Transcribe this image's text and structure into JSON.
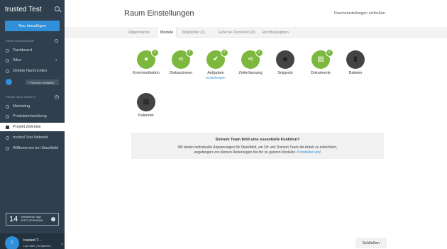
{
  "sidebar": {
    "brand": "trusted Test",
    "add_button": "Neu hinzufügen",
    "org_section": "DEINE ORGANISATION",
    "nav": [
      {
        "label": "Dashboard",
        "icon": "dashboard-icon"
      },
      {
        "label": "Alles",
        "icon": "feed-icon"
      },
      {
        "label": "Direkte Nachrichten",
        "icon": "chat-icon"
      }
    ],
    "invite": "+ Personen einladen",
    "rooms_section": "RÄUME NACH NAMEN ▾",
    "rooms": [
      {
        "label": "Marketing",
        "active": false
      },
      {
        "label": "Produktentwicklung",
        "active": false
      },
      {
        "label": "Projekt Zeitreise",
        "active": true
      },
      {
        "label": "trusted Test Network",
        "active": false
      },
      {
        "label": "Willkommen bei Stackfield",
        "active": false
      }
    ],
    "trial": {
      "days": "14",
      "line1": "verbleibende Tage",
      "line2": "JETZT UPGRADEN"
    },
    "user": {
      "initial": "T",
      "name": "trusted T. -",
      "status": "Live Hilfe | Empfehlen"
    }
  },
  "header": {
    "title": "Raum Einstellungen",
    "close_link": "Raumeinstellungen schließen"
  },
  "tabs": [
    {
      "label": "Allgemeines",
      "active": false
    },
    {
      "label": "Module",
      "active": true
    },
    {
      "label": "Mitglieder (1)",
      "active": false
    },
    {
      "label": "Externe Personen (0)",
      "active": false
    },
    {
      "label": "Rechtegruppen",
      "active": false
    }
  ],
  "modules": [
    {
      "label": "Kommunikation",
      "enabled": true,
      "icon": "chat-bubble-icon"
    },
    {
      "label": "Diskussionen",
      "enabled": true,
      "icon": "share-icon"
    },
    {
      "label": "Aufgaben",
      "enabled": true,
      "icon": "checkmark-icon",
      "sub": "Einstellungen"
    },
    {
      "label": "Zeiterfassung",
      "enabled": true,
      "icon": "share-icon"
    },
    {
      "label": "Snippets",
      "enabled": false,
      "icon": "snippet-icon"
    },
    {
      "label": "Dokumente",
      "enabled": true,
      "icon": "document-icon"
    },
    {
      "label": "Dateien",
      "enabled": false,
      "icon": "file-icon"
    },
    {
      "label": "Kalender",
      "enabled": false,
      "icon": "calendar-icon"
    }
  ],
  "info": {
    "title": "Deinem Team fehlt eine essentielle Funktion?",
    "line1": "Wir bieten individuelle Anpassungen für Stackfield, um Dir und Deinem Team die Arbeit zu erleichtern,",
    "line2": "angefangen von kleinen Änderungen bis hin zu ganzen Modulen.",
    "link": "Kontaktier uns!"
  },
  "footer": {
    "close_button": "Schließen"
  },
  "colors": {
    "sidebar": "#2f3f4d",
    "accent": "#2f8fd8",
    "enabled": "#7bb83d",
    "disabled": "#444444"
  }
}
